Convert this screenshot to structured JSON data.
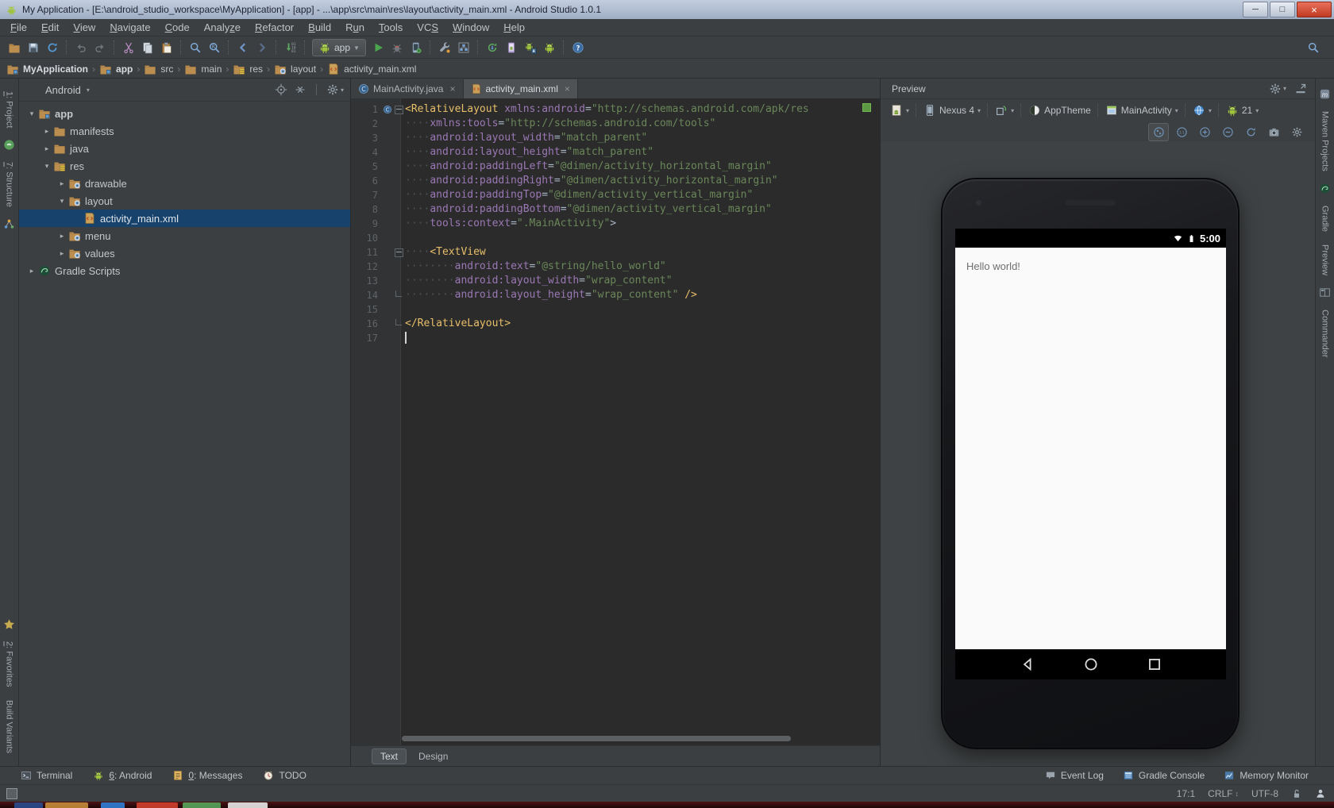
{
  "colors": {
    "panel_bg": "#3c3f41",
    "editor_bg": "#2b2b2b",
    "selection": "#17426b",
    "android_green": "#9fc43c",
    "tag": "#e8bf6a",
    "attribute": "#9b78b5",
    "string": "#6a8759",
    "text": "#bbbbbb",
    "taskbar_blobs": [
      "#2a4d8f",
      "#c58c3a",
      "#2f7fd6",
      "#d2402e",
      "#58a55c",
      "#e8e8e8"
    ]
  },
  "titlebar": {
    "title": "My Application - [E:\\android_studio_workspace\\MyApplication] - [app] - ...\\app\\src\\main\\res\\layout\\activity_main.xml - Android Studio 1.0.1",
    "controls": [
      {
        "name": "minimize",
        "glyph": "─"
      },
      {
        "name": "maximize",
        "glyph": "□"
      },
      {
        "name": "close",
        "glyph": "×"
      }
    ]
  },
  "menubar": {
    "items": [
      {
        "label": "File",
        "mnemonic": 0
      },
      {
        "label": "Edit",
        "mnemonic": 0
      },
      {
        "label": "View",
        "mnemonic": 0
      },
      {
        "label": "Navigate",
        "mnemonic": 0
      },
      {
        "label": "Code",
        "mnemonic": 0
      },
      {
        "label": "Analyze",
        "mnemonic": 5
      },
      {
        "label": "Refactor",
        "mnemonic": 0
      },
      {
        "label": "Build",
        "mnemonic": 0
      },
      {
        "label": "Run",
        "mnemonic": 1
      },
      {
        "label": "Tools",
        "mnemonic": 0
      },
      {
        "label": "VCS",
        "mnemonic": 2
      },
      {
        "label": "Window",
        "mnemonic": 0
      },
      {
        "label": "Help",
        "mnemonic": 0
      }
    ]
  },
  "toolbar": {
    "groups": [
      {
        "icons": [
          {
            "n": "open"
          },
          {
            "n": "save"
          },
          {
            "n": "sync-ide"
          }
        ]
      },
      {
        "icons": [
          {
            "n": "undo",
            "dim": true
          },
          {
            "n": "redo",
            "dim": true
          }
        ]
      },
      {
        "icons": [
          {
            "n": "cut"
          },
          {
            "n": "copy"
          },
          {
            "n": "paste"
          }
        ]
      },
      {
        "icons": [
          {
            "n": "find"
          },
          {
            "n": "replace"
          }
        ]
      },
      {
        "icons": [
          {
            "n": "back"
          },
          {
            "n": "forward",
            "dim": true
          }
        ]
      },
      {
        "icons": [
          {
            "n": "update"
          }
        ]
      }
    ],
    "run_config": {
      "label": "app",
      "icon": "android"
    },
    "groups2": [
      {
        "icons": [
          {
            "n": "run"
          },
          {
            "n": "debug"
          },
          {
            "n": "attach-debugger"
          }
        ]
      },
      {
        "icons": [
          {
            "n": "settings-wrench"
          },
          {
            "n": "project-structure"
          }
        ]
      },
      {
        "icons": [
          {
            "n": "gradle-sync"
          },
          {
            "n": "avd-manager"
          },
          {
            "n": "sdk-manager"
          },
          {
            "n": "device-monitor"
          }
        ]
      },
      {
        "icons": [
          {
            "n": "help"
          }
        ]
      }
    ],
    "right_icons": [
      {
        "n": "search"
      }
    ]
  },
  "breadcrumbs": [
    {
      "label": "MyApplication",
      "icon": "folder-app",
      "em": true
    },
    {
      "label": "app",
      "icon": "folder-app",
      "em": true
    },
    {
      "label": "src",
      "icon": "folder",
      "em": false
    },
    {
      "label": "main",
      "icon": "folder",
      "em": false
    },
    {
      "label": "res",
      "icon": "folder-res",
      "em": false
    },
    {
      "label": "layout",
      "icon": "folder-resource",
      "em": false
    },
    {
      "label": "activity_main.xml",
      "icon": "xml-file",
      "em": false
    }
  ],
  "left_stripe": {
    "top": [
      {
        "type": "label",
        "label": "1: Project",
        "mnemonic": 0
      },
      {
        "type": "icon",
        "icon": "android-circle"
      },
      {
        "type": "label",
        "label": "7: Structure",
        "mnemonic": 0
      },
      {
        "type": "icon",
        "icon": "structure-nodes"
      }
    ],
    "bottom": [
      {
        "type": "icon",
        "icon": "star"
      },
      {
        "type": "label",
        "label": "2: Favorites",
        "mnemonic": 0
      },
      {
        "type": "label",
        "label": "Build Variants",
        "mnemonic": -1
      }
    ]
  },
  "right_stripe": {
    "items": [
      {
        "type": "icon",
        "icon": "maven"
      },
      {
        "type": "label",
        "label": "Maven Projects"
      },
      {
        "type": "icon",
        "icon": "gradle"
      },
      {
        "type": "label",
        "label": "Gradle"
      },
      {
        "type": "label",
        "label": "Preview"
      },
      {
        "type": "icon",
        "icon": "commander"
      },
      {
        "type": "label",
        "label": "Commander"
      }
    ]
  },
  "project_panel": {
    "view": "Android",
    "header_icons": [
      "target",
      "collapse-all",
      "gear"
    ],
    "tree": [
      {
        "indent": 0,
        "arrow": "v",
        "icon": "folder-app",
        "label": "app",
        "bold": true
      },
      {
        "indent": 1,
        "arrow": ">",
        "icon": "folder",
        "label": "manifests"
      },
      {
        "indent": 1,
        "arrow": ">",
        "icon": "folder",
        "label": "java"
      },
      {
        "indent": 1,
        "arrow": "v",
        "icon": "folder-res",
        "label": "res"
      },
      {
        "indent": 2,
        "arrow": ">",
        "icon": "folder-resource",
        "label": "drawable"
      },
      {
        "indent": 2,
        "arrow": "v",
        "icon": "folder-resource",
        "label": "layout"
      },
      {
        "indent": 3,
        "arrow": "",
        "icon": "xml-file",
        "label": "activity_main.xml",
        "selected": true
      },
      {
        "indent": 2,
        "arrow": ">",
        "icon": "folder-resource",
        "label": "menu"
      },
      {
        "indent": 2,
        "arrow": ">",
        "icon": "folder-resource",
        "label": "values"
      },
      {
        "indent": 0,
        "arrow": ">",
        "icon": "gradle",
        "label": "Gradle Scripts"
      }
    ]
  },
  "editor": {
    "tabs": [
      {
        "label": "MainActivity.java",
        "icon": "class-c",
        "active": false
      },
      {
        "label": "activity_main.xml",
        "icon": "xml-file",
        "active": true
      }
    ],
    "bottom_tabs": [
      {
        "label": "Text",
        "active": true
      },
      {
        "label": "Design",
        "active": false
      }
    ],
    "lines": [
      {
        "n": 1,
        "gic": "class-c",
        "fold": "start",
        "t": [
          [
            "g",
            "<RelativeLayout"
          ],
          [
            "p",
            " "
          ],
          [
            "a",
            "xmlns:android"
          ],
          [
            "p",
            "="
          ],
          [
            "v",
            "\"http://schemas.android.com/apk/res"
          ]
        ]
      },
      {
        "n": 2,
        "t": [
          [
            "w",
            "····"
          ],
          [
            "a",
            "xmlns:tools"
          ],
          [
            "p",
            "="
          ],
          [
            "v",
            "\"http://schemas.android.com/tools\""
          ]
        ]
      },
      {
        "n": 3,
        "t": [
          [
            "w",
            "····"
          ],
          [
            "a",
            "android:layout_width"
          ],
          [
            "p",
            "="
          ],
          [
            "v",
            "\"match_parent\""
          ]
        ]
      },
      {
        "n": 4,
        "t": [
          [
            "w",
            "····"
          ],
          [
            "a",
            "android:layout_height"
          ],
          [
            "p",
            "="
          ],
          [
            "v",
            "\"match_parent\""
          ]
        ]
      },
      {
        "n": 5,
        "t": [
          [
            "w",
            "····"
          ],
          [
            "a",
            "android:paddingLeft"
          ],
          [
            "p",
            "="
          ],
          [
            "v",
            "\"@dimen/activity_horizontal_margin\""
          ]
        ]
      },
      {
        "n": 6,
        "t": [
          [
            "w",
            "····"
          ],
          [
            "a",
            "android:paddingRight"
          ],
          [
            "p",
            "="
          ],
          [
            "v",
            "\"@dimen/activity_horizontal_margin\""
          ]
        ]
      },
      {
        "n": 7,
        "t": [
          [
            "w",
            "····"
          ],
          [
            "a",
            "android:paddingTop"
          ],
          [
            "p",
            "="
          ],
          [
            "v",
            "\"@dimen/activity_vertical_margin\""
          ]
        ]
      },
      {
        "n": 8,
        "t": [
          [
            "w",
            "····"
          ],
          [
            "a",
            "android:paddingBottom"
          ],
          [
            "p",
            "="
          ],
          [
            "v",
            "\"@dimen/activity_vertical_margin\""
          ]
        ]
      },
      {
        "n": 9,
        "t": [
          [
            "w",
            "····"
          ],
          [
            "a",
            "tools:context"
          ],
          [
            "p",
            "="
          ],
          [
            "v",
            "\".MainActivity\""
          ],
          [
            "p",
            ">"
          ]
        ]
      },
      {
        "n": 10,
        "t": []
      },
      {
        "n": 11,
        "fold": "start",
        "t": [
          [
            "w",
            "····"
          ],
          [
            "g",
            "<TextView"
          ]
        ]
      },
      {
        "n": 12,
        "t": [
          [
            "w",
            "········"
          ],
          [
            "a",
            "android:text"
          ],
          [
            "p",
            "="
          ],
          [
            "v",
            "\"@string/hello_world\""
          ]
        ]
      },
      {
        "n": 13,
        "t": [
          [
            "w",
            "········"
          ],
          [
            "a",
            "android:layout_width"
          ],
          [
            "p",
            "="
          ],
          [
            "v",
            "\"wrap_content\""
          ]
        ]
      },
      {
        "n": 14,
        "fold": "end",
        "t": [
          [
            "w",
            "········"
          ],
          [
            "a",
            "android:layout_height"
          ],
          [
            "p",
            "="
          ],
          [
            "v",
            "\"wrap_content\""
          ],
          [
            "p",
            " "
          ],
          [
            "g",
            "/>"
          ]
        ]
      },
      {
        "n": 15,
        "t": []
      },
      {
        "n": 16,
        "fold": "end",
        "t": [
          [
            "g",
            "</RelativeLayout>"
          ]
        ]
      },
      {
        "n": 17,
        "t": [
          [
            "caret",
            ""
          ]
        ]
      }
    ]
  },
  "preview": {
    "title": "Preview",
    "header_icons": [
      "gear",
      "hide"
    ],
    "config_items": [
      {
        "name": "layout-config",
        "icon": "page-android",
        "label": "",
        "arrow": true
      },
      {
        "name": "device-select",
        "icon": "device",
        "label": "Nexus 4",
        "arrow": true
      },
      {
        "name": "orientation-select",
        "icon": "orientation",
        "label": "",
        "arrow": true
      },
      {
        "name": "theme-select",
        "icon": "theme",
        "label": "AppTheme",
        "arrow": false
      },
      {
        "name": "activity-select",
        "icon": "activity",
        "label": "MainActivity",
        "arrow": true
      },
      {
        "name": "locale-select",
        "icon": "globe",
        "label": "",
        "arrow": true
      },
      {
        "name": "api-select",
        "icon": "android",
        "label": "21",
        "arrow": true
      }
    ],
    "zoom_controls": [
      {
        "name": "zoom-fit",
        "active": true
      },
      {
        "name": "actual-size",
        "active": false
      },
      {
        "name": "zoom-in",
        "active": false
      },
      {
        "name": "zoom-out",
        "active": false
      },
      {
        "name": "refresh",
        "active": false
      },
      {
        "name": "screenshot",
        "active": false
      },
      {
        "name": "gear",
        "active": false
      }
    ],
    "device": {
      "status_time": "5:00",
      "status_icons": [
        "wifi",
        "battery"
      ],
      "content_text": "Hello world!",
      "nav_icons": [
        "nav-back",
        "nav-home",
        "nav-recents"
      ]
    }
  },
  "bottom_bar": {
    "left": [
      {
        "label": "Terminal",
        "icon": "terminal",
        "mnemonic": -1
      },
      {
        "label": "6: Android",
        "icon": "android",
        "mnemonic": 0
      },
      {
        "label": "0: Messages",
        "icon": "messages",
        "mnemonic": 0
      },
      {
        "label": "TODO",
        "icon": "todo",
        "mnemonic": -1
      }
    ],
    "right": [
      {
        "label": "Event Log",
        "icon": "bubble",
        "mnemonic": -1
      },
      {
        "label": "Gradle Console",
        "icon": "console",
        "mnemonic": -1
      },
      {
        "label": "Memory Monitor",
        "icon": "chart",
        "mnemonic": -1
      }
    ]
  },
  "status_bar": {
    "caret_position": "17:1",
    "line_separator": "CRLF",
    "encoding": "UTF-8",
    "icons": [
      "lock-open",
      "hector"
    ]
  }
}
